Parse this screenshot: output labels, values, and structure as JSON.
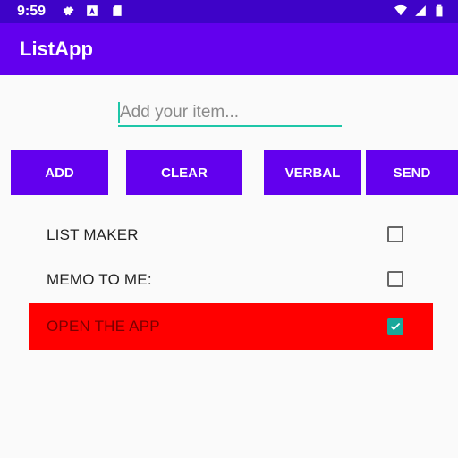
{
  "status_bar": {
    "time": "9:59",
    "icons": [
      "gear-icon",
      "a-icon",
      "sd-card-icon",
      "wifi-icon",
      "signal-icon",
      "battery-icon"
    ]
  },
  "app_bar": {
    "title": "ListApp"
  },
  "input": {
    "placeholder": "Add your item...",
    "value": ""
  },
  "buttons": {
    "add": "ADD",
    "clear": "CLEAR",
    "verbal": "VERBAL",
    "send": "SEND"
  },
  "list": {
    "items": [
      {
        "label": "LIST MAKER",
        "checked": false
      },
      {
        "label": "MEMO TO ME:",
        "checked": false
      },
      {
        "label": "OPEN THE APP",
        "checked": true
      }
    ]
  },
  "colors": {
    "status_bar": "#3e03c8",
    "primary": "#6200ee",
    "accent": "#1ec6a8",
    "highlight_row": "#ff0000"
  }
}
